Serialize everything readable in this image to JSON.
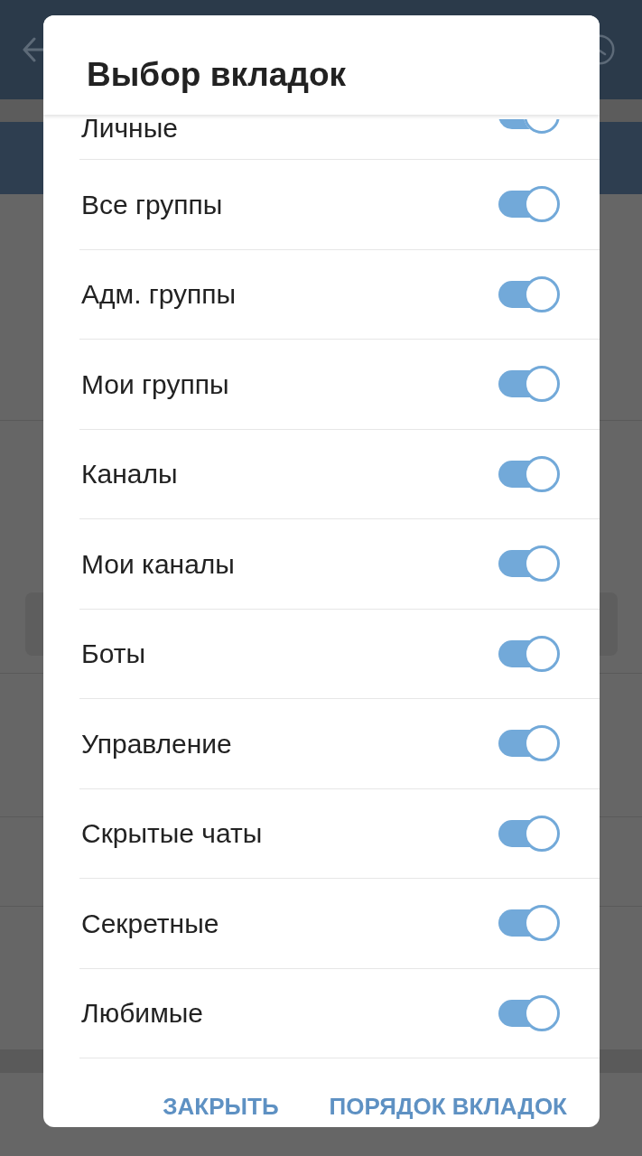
{
  "dialog": {
    "title": "Выбор вкладок",
    "tabs": [
      {
        "label": "Личные",
        "on": true
      },
      {
        "label": "Все группы",
        "on": true
      },
      {
        "label": "Адм. группы",
        "on": true
      },
      {
        "label": "Мои группы",
        "on": true
      },
      {
        "label": "Каналы",
        "on": true
      },
      {
        "label": "Мои каналы",
        "on": true
      },
      {
        "label": "Боты",
        "on": true
      },
      {
        "label": "Управление",
        "on": true
      },
      {
        "label": "Скрытые чаты",
        "on": true
      },
      {
        "label": "Секретные",
        "on": true
      },
      {
        "label": "Любимые",
        "on": true
      }
    ],
    "buttons": [
      {
        "label": "ЗАКРЫТЬ"
      },
      {
        "label": "ПОРЯДОК ВКЛАДОК"
      }
    ]
  }
}
